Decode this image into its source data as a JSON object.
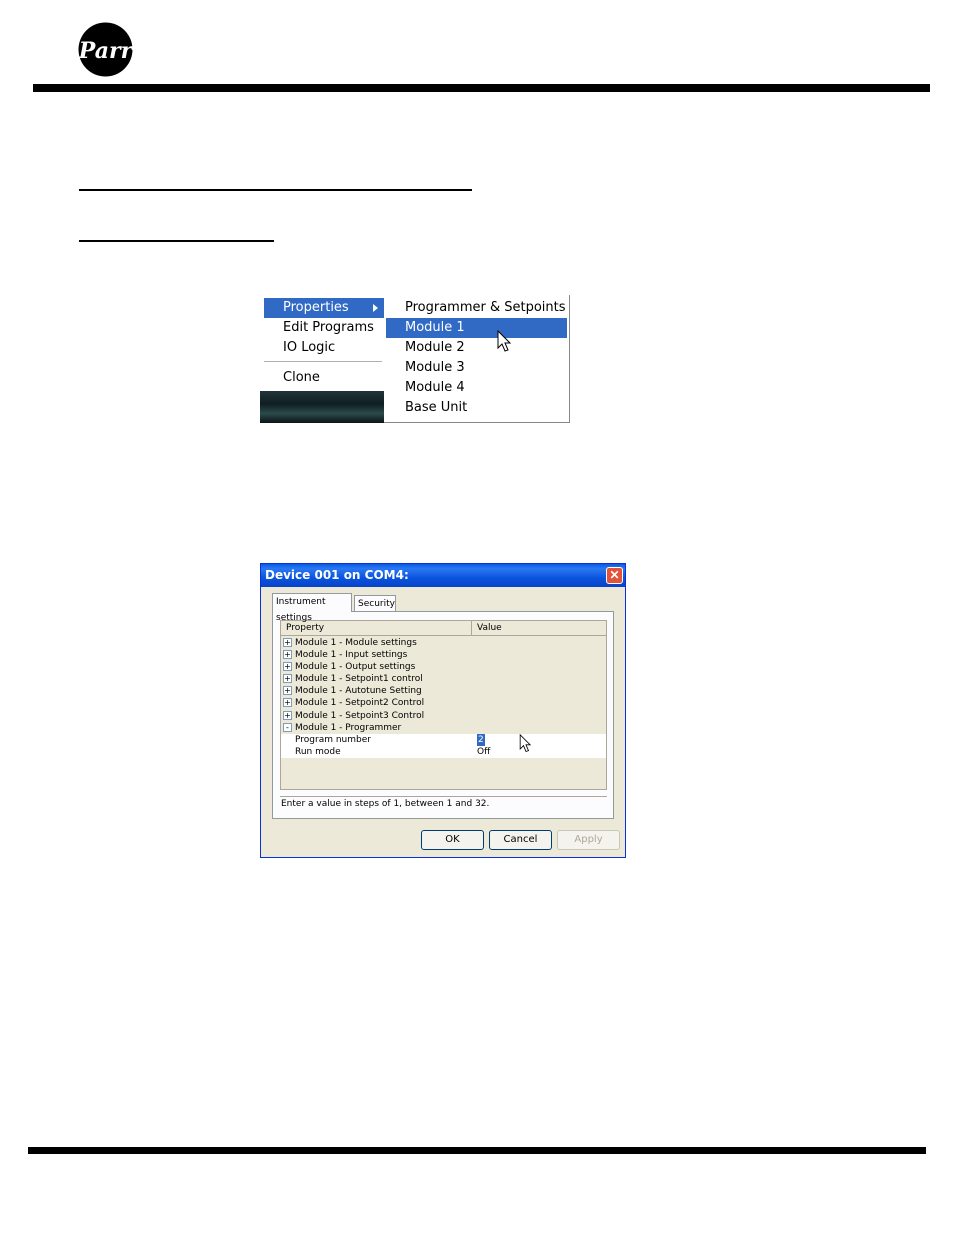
{
  "header": {
    "logo_text": "Parr"
  },
  "context_menu": {
    "left_items": [
      {
        "label": "Properties",
        "selected": true,
        "has_submenu": true
      },
      {
        "label": "Edit Programs",
        "selected": false
      },
      {
        "label": "IO Logic",
        "selected": false
      },
      {
        "label": "Clone",
        "selected": false
      }
    ],
    "submenu_items": [
      {
        "label": "Programmer & Setpoints",
        "selected": false
      },
      {
        "label": "Module 1",
        "selected": true
      },
      {
        "label": "Module 2",
        "selected": false
      },
      {
        "label": "Module 3",
        "selected": false
      },
      {
        "label": "Module 4",
        "selected": false
      },
      {
        "label": "Base Unit",
        "selected": false
      }
    ]
  },
  "dialog": {
    "title": "Device 001 on COM4:",
    "close_glyph": "✕",
    "tabs": [
      "Instrument settings",
      "Security"
    ],
    "columns": {
      "property": "Property",
      "value": "Value"
    },
    "groups": [
      {
        "label": "Module 1 - Module settings",
        "expander": "+"
      },
      {
        "label": "Module 1 - Input settings",
        "expander": "+"
      },
      {
        "label": "Module 1 - Output settings",
        "expander": "+"
      },
      {
        "label": "Module 1 - Setpoint1 control",
        "expander": "+"
      },
      {
        "label": "Module 1 - Autotune Setting",
        "expander": "+"
      },
      {
        "label": "Module 1 - Setpoint2 Control",
        "expander": "+"
      },
      {
        "label": "Module 1 - Setpoint3 Control",
        "expander": "+"
      },
      {
        "label": "Module 1 - Programmer",
        "expander": "-"
      }
    ],
    "properties": [
      {
        "label": "Program number",
        "value": "2"
      },
      {
        "label": "Run mode",
        "value": "Off"
      }
    ],
    "status_text": "Enter a value in steps of 1, between 1 and 32.",
    "buttons": {
      "ok": "OK",
      "cancel": "Cancel",
      "apply": "Apply"
    },
    "colors": {
      "titlebar": "#0a5ae6",
      "selection": "#316ac5",
      "face": "#ece9d8"
    }
  }
}
